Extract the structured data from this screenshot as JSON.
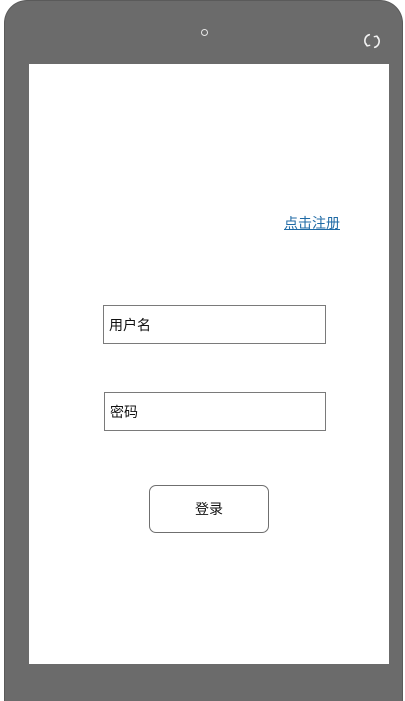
{
  "device": {
    "camera_icon": "camera-dot-icon",
    "rotate_icon": "rotate-icon"
  },
  "screen": {
    "register_link": "点击注册",
    "username_field": {
      "value": "用户名",
      "placeholder": ""
    },
    "password_field": {
      "value": "密码",
      "placeholder": ""
    },
    "login_button": "登录"
  },
  "colors": {
    "device_frame": "#6b6b6b",
    "screen_background": "#ffffff",
    "link": "#1f6aa5",
    "border": "#7a7a7a"
  }
}
